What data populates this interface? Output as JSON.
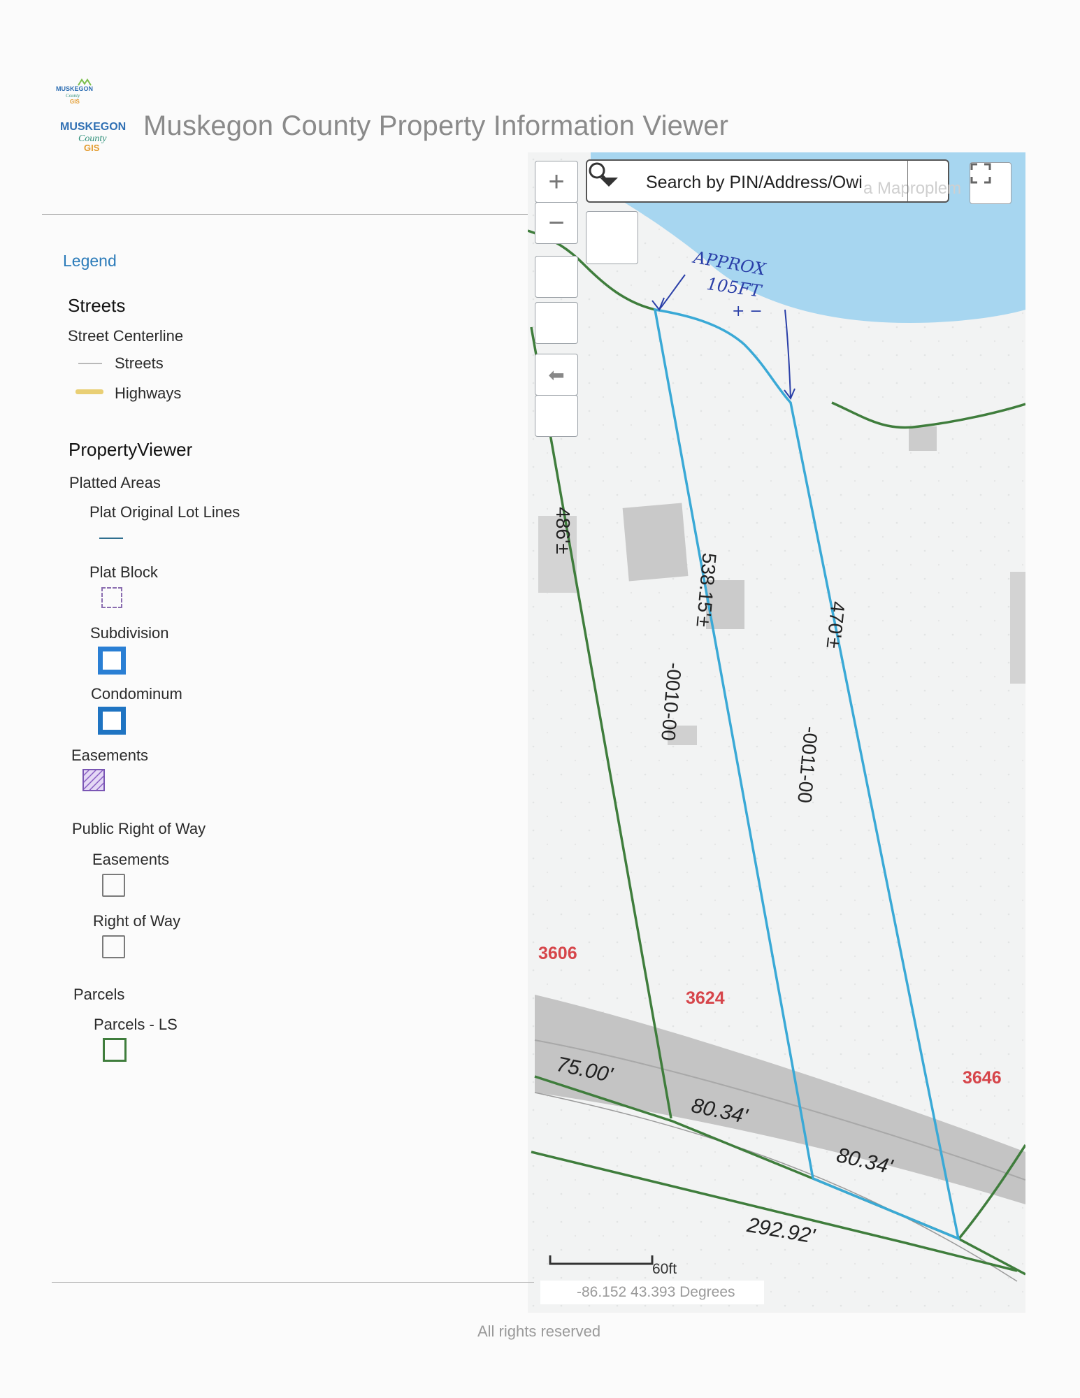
{
  "header": {
    "title": "Muskegon County Property Information Viewer",
    "logo_text": [
      "MUSKEGON",
      "County",
      "GIS"
    ]
  },
  "legend": {
    "title": "Legend",
    "streets": {
      "heading": "Streets",
      "group": "Street Centerline",
      "items": [
        {
          "label": "Streets",
          "color": "#b9b9b9"
        },
        {
          "label": "Highways",
          "color": "#e9cf74"
        }
      ]
    },
    "property_viewer": {
      "heading": "PropertyViewer",
      "platted_areas": "Platted Areas",
      "plat_original_lot_lines": "Plat Original Lot Lines",
      "plat_block": "Plat Block",
      "subdivision": "Subdivision",
      "condominum": "Condominum",
      "easements": "Easements",
      "public_right_of_way": "Public Right of Way",
      "prw_easements": "Easements",
      "right_of_way": "Right of Way",
      "parcels": "Parcels",
      "parcels_ls": "Parcels - LS"
    }
  },
  "map": {
    "search_placeholder": "Search by PIN/Address/Owi",
    "ghost_text": "a Maproplem",
    "zoom_in": "+",
    "zoom_out": "−",
    "back_arrow": "⬅",
    "annotation": [
      "APPROX",
      "105FT",
      "+ −"
    ],
    "dimensions": {
      "west_line": "486'±",
      "middle_line": "538.15'±",
      "east_line": "470'±",
      "south_a": "75.00'",
      "south_b": "80.34'",
      "south_c": "80.34'",
      "road": "292.92'"
    },
    "parcel_ids": [
      "-0010-00",
      "-0011-00"
    ],
    "addresses": [
      "3606",
      "3624",
      "3646"
    ],
    "scale_label": "60ft",
    "coordinates": "-86.152 43.393 Degrees",
    "colors": {
      "water": "#a7d6f0",
      "parcel_green": "#3f7d3c",
      "highlight": "#3aa9d6",
      "address": "#d6454a",
      "road": "#c4c4c4"
    }
  },
  "footer": {
    "text": "All rights reserved"
  }
}
